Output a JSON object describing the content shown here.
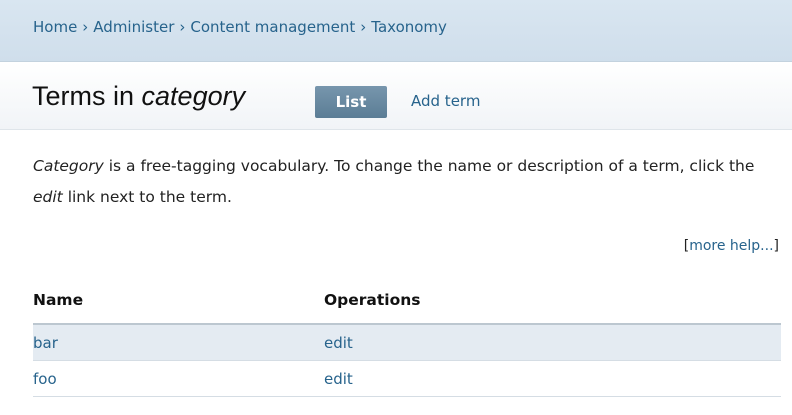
{
  "breadcrumb": {
    "items": [
      "Home",
      "Administer",
      "Content management",
      "Taxonomy"
    ],
    "separator": "›"
  },
  "page": {
    "title_prefix": "Terms in ",
    "title_vocab": "category"
  },
  "tabs": {
    "list_label": "List",
    "add_label": "Add term"
  },
  "description": {
    "vocab_name": "Category",
    "text_part1": " is a free-tagging vocabulary. To change the name or description of a term, click the ",
    "edit_word": "edit",
    "text_part2": " link next to the term."
  },
  "help": {
    "open_bracket": "[",
    "link_label": "more help...",
    "close_bracket": "]"
  },
  "table": {
    "headers": [
      "Name",
      "Operations"
    ],
    "rows": [
      {
        "name": "bar",
        "operation": "edit"
      },
      {
        "name": "foo",
        "operation": "edit"
      }
    ]
  },
  "colors": {
    "link": "#27638c",
    "breadcrumb_bg": "#d9e6f1",
    "active_tab": "#5b7d95",
    "row_stripe": "#e4ebf2"
  }
}
